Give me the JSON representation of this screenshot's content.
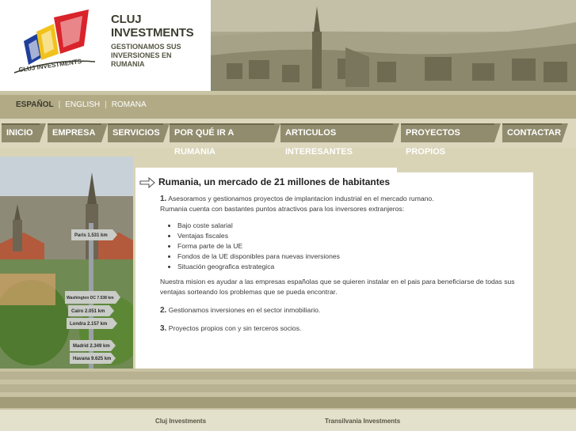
{
  "brand": {
    "title_line1": "CLUJ",
    "title_line2": "INVESTMENTS",
    "tagline": "GESTIONAMOS SUS INVERSIONES EN RUMANIA",
    "logo_text": "CLUJ INVESTMENTS",
    "colors": {
      "red": "#d8242a",
      "yellow": "#f1c21b",
      "blue": "#1f3f9a"
    }
  },
  "languages": [
    {
      "label": "ESPAÑOL",
      "active": true
    },
    {
      "label": "ENGLISH",
      "active": false
    },
    {
      "label": "ROMANA",
      "active": false
    }
  ],
  "language_sep": "|",
  "nav": [
    {
      "label": "INICIO"
    },
    {
      "label": "EMPRESA"
    },
    {
      "label": "SERVICIOS"
    },
    {
      "label": "POR QUÉ IR A RUMANIA"
    },
    {
      "label": "ARTICULOS INTERESANTES"
    },
    {
      "label": "PROYECTOS PROPIOS"
    },
    {
      "label": "CONTACTAR"
    }
  ],
  "content": {
    "heading": "Rumania, un mercado de 21 millones de habitantes",
    "p1_num": "1.",
    "p1": "Asesoramos y gestionamos proyectos de implantacion industrial en el mercado rumano.",
    "p1b": "Rumania cuenta con bastantes puntos atractivos para los inversores extranjeros:",
    "bullets": [
      "Bajo coste salarial",
      "Ventajas fiscales",
      "Forma parte de la UE",
      "Fondos de la UE disponibles para nuevas inversiones",
      "Situación geografica estrategica"
    ],
    "mission": "Nuestra mision es ayudar a las empresas españolas que se quieren instalar en el pais para beneficiarse de todas sus ventajas sorteando los problemas que se pueda encontrar.",
    "p2_num": "2.",
    "p2": "Gestionamos inversiones en el sector inmobiliario.",
    "p3_num": "3.",
    "p3": "Proyectos propios con y sin terceros socios."
  },
  "signpost": [
    "Paris 1.531 km",
    "Washington DC 7.538 km",
    "Cairo 2.051 km",
    "Londra 2.157 km",
    "Madrid 2.349 km",
    "Havana 9.625 km"
  ],
  "footer": {
    "col1_title": "Cluj Investments",
    "col2_title": "Transilvania Investments"
  }
}
